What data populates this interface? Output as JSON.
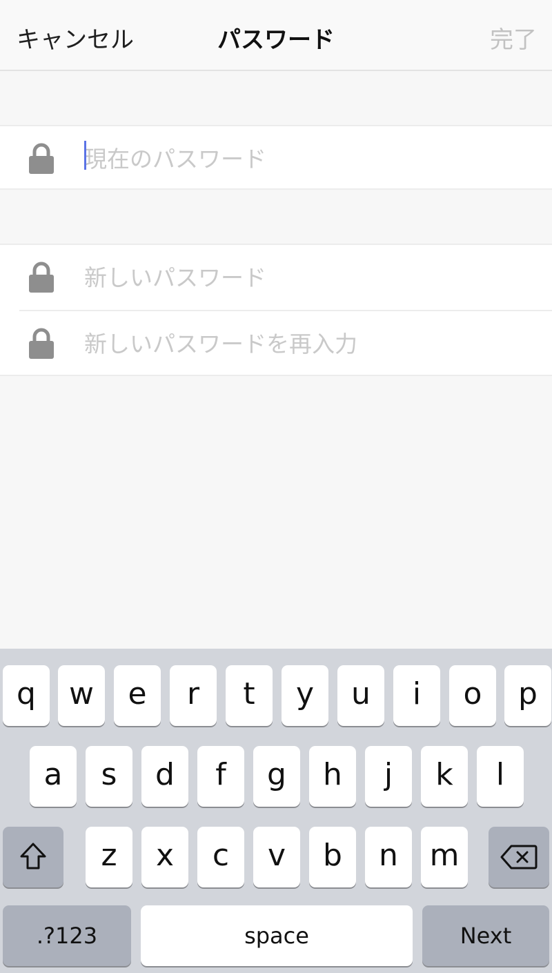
{
  "nav": {
    "cancel_label": "キャンセル",
    "title": "パスワード",
    "done_label": "完了"
  },
  "fields": {
    "current_password_placeholder": "現在のパスワード",
    "new_password_placeholder": "新しいパスワード",
    "confirm_password_placeholder": "新しいパスワードを再入力"
  },
  "keyboard": {
    "row1": [
      "q",
      "w",
      "e",
      "r",
      "t",
      "y",
      "u",
      "i",
      "o",
      "p"
    ],
    "row2": [
      "a",
      "s",
      "d",
      "f",
      "g",
      "h",
      "j",
      "k",
      "l"
    ],
    "row3": [
      "z",
      "x",
      "c",
      "v",
      "b",
      "n",
      "m"
    ],
    "shift_icon": "shift-icon",
    "delete_icon": "backspace-icon",
    "numbers_label": ".?123",
    "space_label": "space",
    "next_label": "Next"
  },
  "colors": {
    "caret": "#5b73e6",
    "done_disabled": "#c2c2c2",
    "keyboard_bg": "#d2d5db"
  }
}
